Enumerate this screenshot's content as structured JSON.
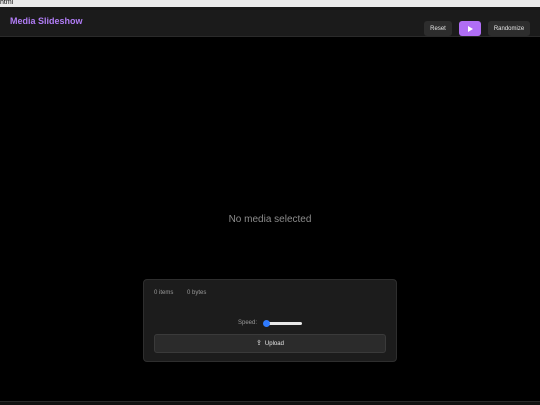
{
  "browser": {
    "label": "html"
  },
  "app": {
    "title": "Media Slideshow"
  },
  "toolbar": {
    "reset_label": "Reset",
    "play_icon": "play-icon",
    "randomize_label": "Randomize"
  },
  "stage": {
    "empty_message": "No media selected"
  },
  "panel": {
    "items_text": "0 items",
    "bytes_text": "0 bytes",
    "speed_label": "Speed:",
    "speed_value": 0.05,
    "upload_label": "Upload",
    "upload_icon": "upload-icon"
  },
  "colors": {
    "accent": "#b07cf5",
    "play_button": "#b06ef5",
    "slider": "#2f7bff",
    "background": "#000000"
  }
}
